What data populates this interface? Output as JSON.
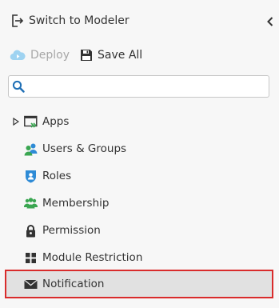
{
  "header": {
    "switch_label": "Switch to Modeler"
  },
  "actions": {
    "deploy_label": "Deploy",
    "save_all_label": "Save All"
  },
  "search": {
    "value": "",
    "placeholder": ""
  },
  "tree": {
    "items": [
      {
        "label": "Apps",
        "icon": "apps-icon",
        "expandable": true
      },
      {
        "label": "Users & Groups",
        "icon": "users-groups-icon"
      },
      {
        "label": "Roles",
        "icon": "roles-shield-icon"
      },
      {
        "label": "Membership",
        "icon": "membership-icon"
      },
      {
        "label": "Permission",
        "icon": "lock-icon"
      },
      {
        "label": "Module Restriction",
        "icon": "module-grid-icon"
      },
      {
        "label": "Notification",
        "icon": "envelope-icon",
        "selected": true
      }
    ]
  },
  "colors": {
    "accent_blue": "#2e8bd6",
    "accent_green": "#3aa651",
    "selection_outline": "#d92c2c",
    "selection_bg": "#e1e1e1",
    "text": "#333333",
    "disabled_text": "#a7a7a7"
  }
}
